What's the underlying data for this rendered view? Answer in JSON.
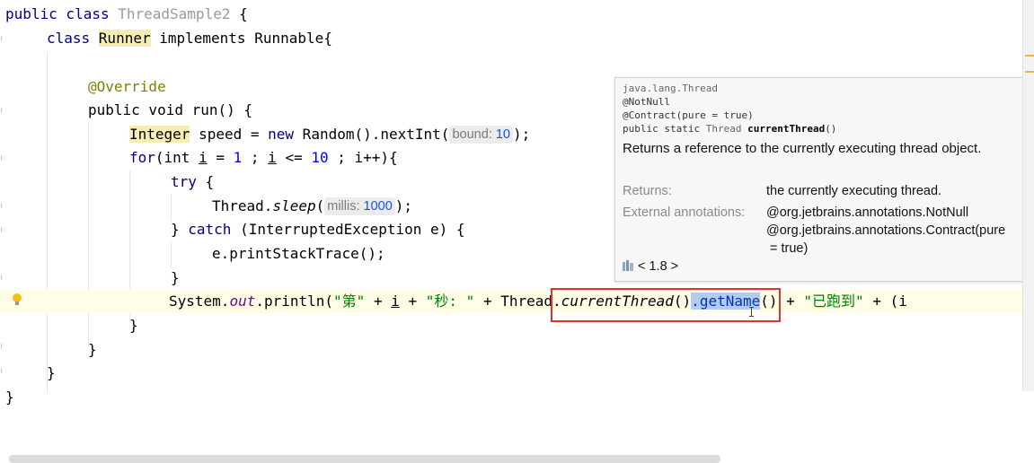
{
  "editor": {
    "lines": [
      {
        "t1": "public class ",
        "t2": "ThreadSample2",
        "t3": " {"
      },
      {
        "t1": "class ",
        "t2": "Runner",
        "t3": " implements Runnable{"
      },
      {
        "t1": "@Override"
      },
      {
        "t1": "public void run() {"
      },
      {
        "t1": "Integer",
        "t2": " speed = ",
        "t3": "new",
        "t4": " Random().nextInt(",
        "hint_name": "bound:",
        "hint_value": "10",
        "t5": ");"
      },
      {
        "t1": "for",
        "t2": "(int ",
        "t3": "i",
        "t4": " = ",
        "t5": "1",
        "t6": " ; ",
        "t7": "i",
        "t8": " <= ",
        "t9": "10",
        "t10": " ; ",
        "t11": "i++){"
      },
      {
        "t1": "try",
        "t2": " {"
      },
      {
        "t1": "Thread.",
        "t2": "sleep",
        "t3": "(",
        "hint_name": "millis:",
        "hint_value": "1000",
        "t4": ");"
      },
      {
        "t1": "} ",
        "t2": "catch",
        "t3": " (InterruptedException e) {"
      },
      {
        "t1": "e.printStackTrace();"
      },
      {
        "t1": "}"
      },
      {
        "t1": "System.",
        "t2": "out",
        "t3": ".println(",
        "t4": "\"第\"",
        "t5": " + ",
        "t6": "i",
        "t7": " + ",
        "t8": "\"秒: \"",
        "t9": " + ",
        "t10": "Thread.",
        "t11": "currentThread",
        "t12": "()",
        "t13": ".",
        "t14": "getName",
        "t15": "() + ",
        "t16": "\"已跑到\"",
        "t17": " + (i"
      },
      {
        "t1": "}"
      },
      {
        "t1": "}"
      },
      {
        "t1": "}"
      },
      {
        "t1": "}"
      }
    ]
  },
  "doc_popup": {
    "package": "java.lang.Thread",
    "annotation1": "@NotNull",
    "annotation2": "@Contract(pure = true)",
    "sig_prefix": "public static ",
    "sig_type": "Thread",
    "sig_name": "currentThread",
    "sig_suffix": "()",
    "description": "Returns a reference to the currently executing thread object.",
    "returns_label": "Returns:",
    "returns_value": "the currently executing thread.",
    "external_label": "External annotations:",
    "external_value1": "@org.jetbrains.annotations.NotNull",
    "external_value2": "@org.jetbrains.annotations.Contract(pure",
    "external_value3": "= true)",
    "jdk_version": "< 1.8 >"
  },
  "colors": {
    "highlight_box": "#e53030",
    "keyword": "#000080",
    "string": "#008000",
    "annotation": "#808000",
    "number": "#0000ff"
  },
  "icons": {
    "gutter": "lightbulb-icon",
    "library": "library-icon"
  }
}
